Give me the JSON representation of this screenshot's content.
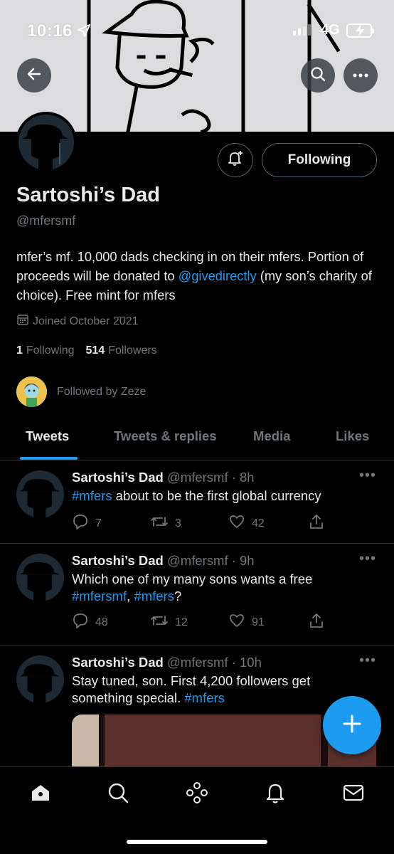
{
  "status_bar": {
    "time": "10:16",
    "network": "4G"
  },
  "profile": {
    "name": "Sartoshi’s Dad",
    "handle": "@mfersmf",
    "bio_before": "mfer’s mf. 10,000 dads checking in on their mfers. Portion of proceeds will be donated to ",
    "bio_link": "@givedirectly",
    "bio_after": " (my son’s charity of choice). Free mint for mfers",
    "joined": "Joined October 2021",
    "following_count": "1",
    "following_label": "Following",
    "followers_count": "514",
    "followers_label": "Followers",
    "followed_by": "Followed by Zeze",
    "follow_button": "Following"
  },
  "tabs": [
    {
      "label": "Tweets",
      "active": true
    },
    {
      "label": "Tweets & replies",
      "active": false
    },
    {
      "label": "Media",
      "active": false
    },
    {
      "label": "Likes",
      "active": false
    }
  ],
  "tweets": [
    {
      "name": "Sartoshi’s Dad",
      "meta": "@mfersmf · 8h",
      "text_parts": [
        {
          "t": "#mfers",
          "tag": true
        },
        {
          "t": " about to be the first global currency",
          "tag": false
        }
      ],
      "replies": "7",
      "retweets": "3",
      "likes": "42"
    },
    {
      "name": "Sartoshi’s Dad",
      "meta": "@mfersmf · 9h",
      "text_parts": [
        {
          "t": "Which one of my many sons wants a free ",
          "tag": false
        },
        {
          "t": "#mfersmf",
          "tag": true
        },
        {
          "t": ", ",
          "tag": false
        },
        {
          "t": "#mfers",
          "tag": true
        },
        {
          "t": "?",
          "tag": false
        }
      ],
      "replies": "48",
      "retweets": "12",
      "likes": "91"
    },
    {
      "name": "Sartoshi’s Dad",
      "meta": "@mfersmf · 10h",
      "text_parts": [
        {
          "t": "Stay tuned, son. First 4,200 followers get something special. ",
          "tag": false
        },
        {
          "t": "#mfers",
          "tag": true
        }
      ]
    }
  ],
  "colors": {
    "accent": "#1d9bf0",
    "background": "#000000",
    "muted": "#71767b"
  },
  "icons": {
    "back": "arrow-left-icon",
    "search": "search-icon",
    "more": "more-icon",
    "bell": "bell-plus-icon",
    "calendar": "calendar-icon",
    "reply": "reply-icon",
    "retweet": "retweet-icon",
    "like": "heart-icon",
    "share": "share-icon",
    "compose": "plus-icon",
    "nav": [
      "home-icon",
      "search-icon",
      "spaces-icon",
      "notifications-icon",
      "messages-icon"
    ]
  }
}
